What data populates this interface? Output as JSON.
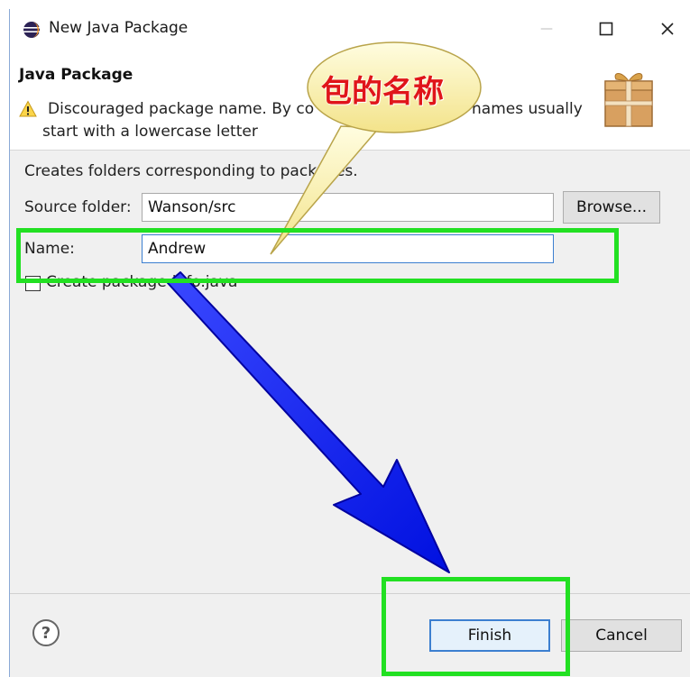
{
  "window": {
    "title": "New Java Package",
    "minimize_glyph": "—",
    "maximize_glyph": "☐",
    "close_glyph": "✕"
  },
  "header": {
    "title": "Java Package",
    "warning_line1": "Discouraged package name. By co",
    "warning_line1_tail": "names usually",
    "warning_line2": "start with a lowercase letter"
  },
  "body": {
    "description": "Creates folders corresponding to packages.",
    "source_folder_label": "Source folder:",
    "source_folder_value": "Wanson/src",
    "browse_label": "Browse...",
    "name_label": "Name:",
    "name_value": "Andrew",
    "checkbox_label": "Create package-info.java",
    "checkbox_checked": false
  },
  "footer": {
    "help_glyph": "?",
    "finish_label": "Finish",
    "cancel_label": "Cancel"
  },
  "annotation": {
    "bubble_text": "包的名称",
    "highlight_color": "#22e022",
    "arrow_color": "#0a17ff",
    "bubble_text_color": "#e0151a"
  },
  "colors": {
    "focus_border": "#3c7fd0",
    "dialog_bg": "#f0f0f0"
  }
}
